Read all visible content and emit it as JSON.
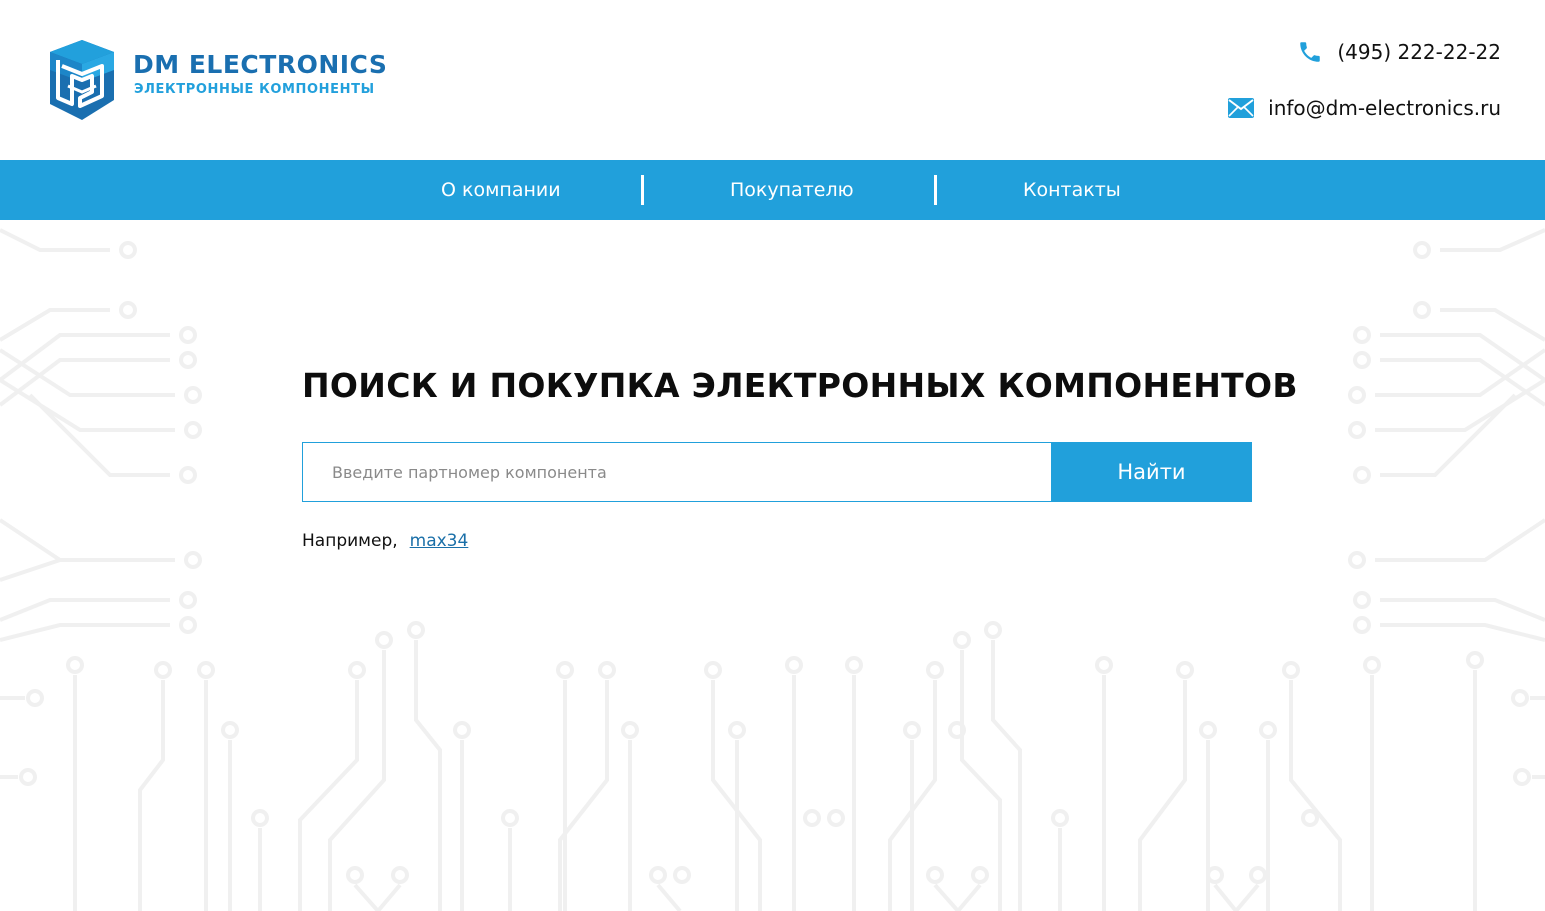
{
  "brand": {
    "name": "DM ELECTRONICS",
    "tagline": "ЭЛЕКТРОННЫЕ КОМПОНЕНТЫ",
    "primary_color": "#21a0db",
    "dark_color": "#1a6fb0",
    "logo_icon": "dm-logo-icon"
  },
  "contacts": {
    "phone": "(495) 222-22-22",
    "phone_icon": "phone-icon",
    "email": "info@dm-electronics.ru",
    "email_icon": "envelope-icon"
  },
  "nav": {
    "items": [
      {
        "label": "О компании"
      },
      {
        "label": "Покупателю"
      },
      {
        "label": "Контакты"
      }
    ]
  },
  "search": {
    "title": "ПОИСК И ПОКУПКА ЭЛЕКТРОННЫХ КОМПОНЕНТОВ",
    "placeholder": "Введите партномер компонента",
    "value": "",
    "button_label": "Найти",
    "example_prefix": "Например,",
    "example_link": "max34"
  }
}
